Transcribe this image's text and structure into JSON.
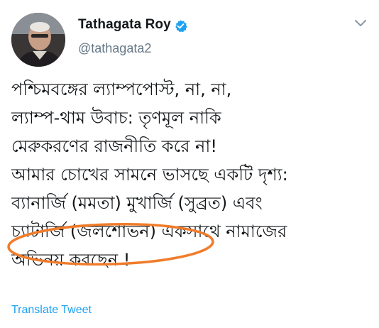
{
  "user": {
    "display_name": "Tathagata Roy",
    "handle": "@tathagata2",
    "verified": true,
    "avatar": "profile-photo"
  },
  "tweet": {
    "lines": [
      "পশ্চিমবঙ্গের ল্যাম্পপোস্ট, না, না,",
      "ল্যাম্প-থাম উবাচ: তৃণমূল নাকি",
      "মেরুকরণের রাজনীতি করে না!",
      "আমার চোখের সামনে ভাসছে একটি দৃশ্য:",
      "ব্যানার্জি (মমতা) মুখার্জি (সুব্রত) এবং",
      "চ্যাটার্জি  (জলশোভন) একসাথে নামাজের",
      "অভিনয় করছেন !"
    ]
  },
  "actions": {
    "translate_label": "Translate Tweet"
  },
  "icons": {
    "verified": "verified-badge-icon",
    "menu": "chevron-down-icon"
  },
  "colors": {
    "verified_blue": "#1da1f2",
    "link_blue": "#1da1f2",
    "handle_gray": "#657786",
    "highlight_orange": "#f07c2b"
  }
}
